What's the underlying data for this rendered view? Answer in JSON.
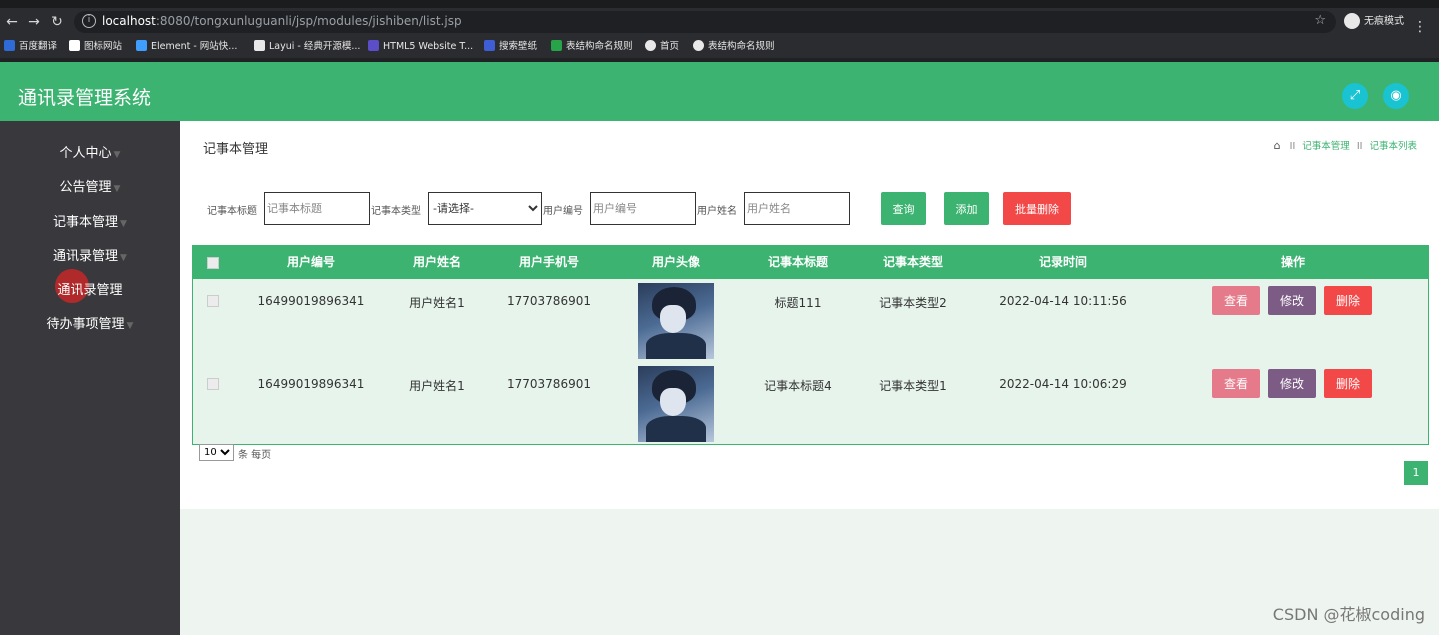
{
  "browser": {
    "url_host": "localhost",
    "url_rest": ":8080/tongxunluguanli/jsp/modules/jishiben/list.jsp",
    "incognito_label": "无痕模式",
    "bookmarks": [
      {
        "label": "百度翻译",
        "color": "#2f6bd6"
      },
      {
        "label": "图标网站",
        "color": "#ffffff"
      },
      {
        "label": "Element - 网站快...",
        "color": "#409eff"
      },
      {
        "label": "Layui - 经典开源模...",
        "color": "#e8e8e8"
      },
      {
        "label": "HTML5 Website T...",
        "color": "#5b4ec8"
      },
      {
        "label": "搜索壁纸",
        "color": "#3f5ed6"
      },
      {
        "label": "表结构命名规则",
        "color": "#27a34a"
      },
      {
        "label": "首页",
        "color": "#e8e8e8"
      },
      {
        "label": "表结构命名规则",
        "color": "#e8e8e8"
      }
    ]
  },
  "header": {
    "title": "通讯录管理系统"
  },
  "sidebar": {
    "items": [
      {
        "label": "个人中心",
        "arrow": "▼"
      },
      {
        "label": "公告管理",
        "arrow": "▼"
      },
      {
        "label": "记事本管理",
        "arrow": "▼"
      },
      {
        "label": "通讯录管理",
        "arrow": "▼"
      },
      {
        "label": "通讯录管理",
        "arrow": ""
      },
      {
        "label": "待办事项管理",
        "arrow": "▼"
      }
    ]
  },
  "main": {
    "page_title": "记事本管理",
    "breadcrumb": {
      "sep": "II",
      "items": [
        "记事本管理",
        "记事本列表"
      ]
    },
    "filters": {
      "title_label": "记事本标题",
      "title_placeholder": "记事本标题",
      "type_label": "记事本类型",
      "type_selected": "-请选择-",
      "user_no_label": "用户编号",
      "user_no_placeholder": "用户编号",
      "user_name_label": "用户姓名",
      "user_name_placeholder": "用户姓名"
    },
    "buttons": {
      "query": "查询",
      "add": "添加",
      "batch_delete": "批量删除"
    },
    "table": {
      "columns": [
        "用户编号",
        "用户姓名",
        "用户手机号",
        "用户头像",
        "记事本标题",
        "记事本类型",
        "记录时间",
        "操作"
      ],
      "rows": [
        {
          "user_no": "16499019896341",
          "user_name": "用户姓名1",
          "phone": "17703786901",
          "title": "标题111",
          "type": "记事本类型2",
          "time": "2022-04-14 10:11:56"
        },
        {
          "user_no": "16499019896341",
          "user_name": "用户姓名1",
          "phone": "17703786901",
          "title": "记事本标题4",
          "type": "记事本类型1",
          "time": "2022-04-14 10:06:29"
        }
      ],
      "actions": {
        "view": "查看",
        "edit": "修改",
        "delete": "删除"
      }
    },
    "pagination": {
      "page_size": "10",
      "page_size_suffix": "条 每页",
      "current_page": "1"
    }
  },
  "colors": {
    "primary": "#3cb371",
    "view_button": "#e57a8a",
    "edit_button": "#7c5b85",
    "delete_button": "#f24848",
    "batch_delete_button": "#f24848",
    "header_icon": "#19c3d1"
  },
  "watermark": "CSDN @花椒coding"
}
